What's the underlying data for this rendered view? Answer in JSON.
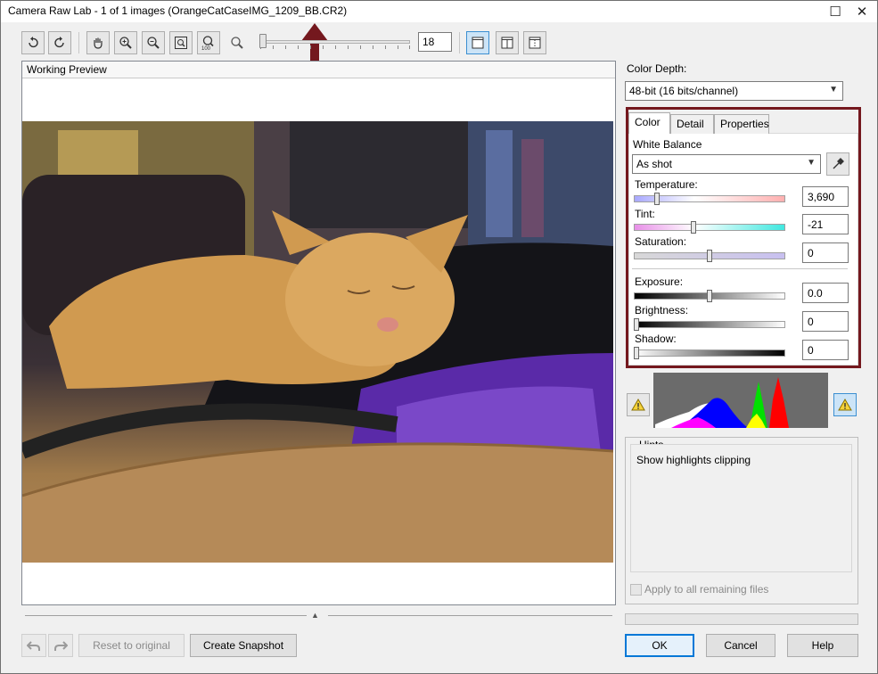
{
  "window": {
    "title": "Camera Raw Lab - 1 of 1 images (OrangeCatCaseIMG_1209_BB.CR2)",
    "maximize_glyph": "☐",
    "close_glyph": "✕"
  },
  "toolbar": {
    "zoom_value": "18",
    "icons": [
      "rotate-left-icon",
      "rotate-right-icon",
      "hand-icon",
      "zoom-in-icon",
      "zoom-out-icon",
      "fit-icon",
      "zoom-100-icon",
      "zoom-small-icon",
      "single-view-icon",
      "split-view-icon",
      "side-view-icon"
    ],
    "zoom_100_label": "100"
  },
  "preview": {
    "header": "Working Preview"
  },
  "color_depth": {
    "label": "Color Depth:",
    "value": "48-bit (16 bits/channel)"
  },
  "tabs": [
    "Color",
    "Detail",
    "Properties"
  ],
  "white_balance": {
    "label": "White Balance",
    "value": "As shot"
  },
  "sliders": [
    {
      "label": "Temperature:",
      "value": "3,690",
      "level": 0.15
    },
    {
      "label": "Tint:",
      "value": "-21",
      "level": 0.4
    },
    {
      "label": "Saturation:",
      "value": "0",
      "level": 0.5
    },
    {
      "label": "Exposure:",
      "value": "0.0",
      "level": 0.5
    },
    {
      "label": "Brightness:",
      "value": "0",
      "level": 0.0
    },
    {
      "label": "Shadow:",
      "value": "0",
      "level": 0.0
    }
  ],
  "hints": {
    "title": "Hints",
    "text": "Show highlights clipping",
    "apply_label": "Apply to all remaining files"
  },
  "bottom": {
    "reset_label": "Reset to original",
    "snapshot_label": "Create Snapshot",
    "ok_label": "OK",
    "cancel_label": "Cancel",
    "help_label": "Help"
  },
  "colors": {
    "highlight_border": "#74181e",
    "arrow": "#74181e",
    "accent": "#0078d7"
  }
}
